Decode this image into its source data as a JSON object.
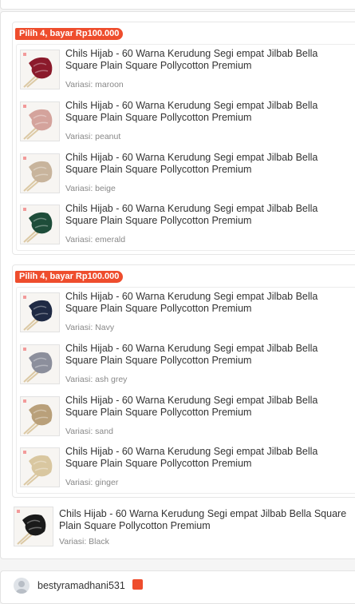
{
  "groups": [
    {
      "promo": "Pilih 4, bayar Rp100.000",
      "items": [
        {
          "title": "Chils Hijab - 60 Warna Kerudung Segi empat Jilbab Bella Square Plain Square Pollycotton Premium",
          "variant": "Variasi: maroon",
          "color": "#8b1a2b"
        },
        {
          "title": "Chils Hijab - 60 Warna Kerudung Segi empat Jilbab Bella Square Plain Square Pollycotton Premium",
          "variant": "Variasi: peanut",
          "color": "#d4a39c"
        },
        {
          "title": "Chils Hijab - 60 Warna Kerudung Segi empat Jilbab Bella Square Plain Square Pollycotton Premium",
          "variant": "Variasi: beige",
          "color": "#c8b49c"
        },
        {
          "title": "Chils Hijab - 60 Warna Kerudung Segi empat Jilbab Bella Square Plain Square Pollycotton Premium",
          "variant": "Variasi: emerald",
          "color": "#1e4d3a"
        }
      ]
    },
    {
      "promo": "Pilih 4, bayar Rp100.000",
      "items": [
        {
          "title": "Chils Hijab - 60 Warna Kerudung Segi empat Jilbab Bella Square Plain Square Pollycotton Premium",
          "variant": "Variasi: Navy",
          "color": "#1f2a44"
        },
        {
          "title": "Chils Hijab - 60 Warna Kerudung Segi empat Jilbab Bella Square Plain Square Pollycotton Premium",
          "variant": "Variasi: ash grey",
          "color": "#8c8f9c"
        },
        {
          "title": "Chils Hijab - 60 Warna Kerudung Segi empat Jilbab Bella Square Plain Square Pollycotton Premium",
          "variant": "Variasi: sand",
          "color": "#b9a07a"
        },
        {
          "title": "Chils Hijab - 60 Warna Kerudung Segi empat Jilbab Bella Square Plain Square Pollycotton Premium",
          "variant": "Variasi: ginger",
          "color": "#d9c7a0"
        }
      ]
    }
  ],
  "solo_item": {
    "title": "Chils Hijab - 60 Warna Kerudung Segi empat Jilbab Bella Square Plain Square Pollycotton Premium",
    "variant": "Variasi: Black",
    "color": "#1a1a1a"
  },
  "review": {
    "username": "bestyramadhani531"
  },
  "colors": {
    "accent": "#ee4d2d",
    "text": "#333333",
    "muted": "#888888"
  }
}
